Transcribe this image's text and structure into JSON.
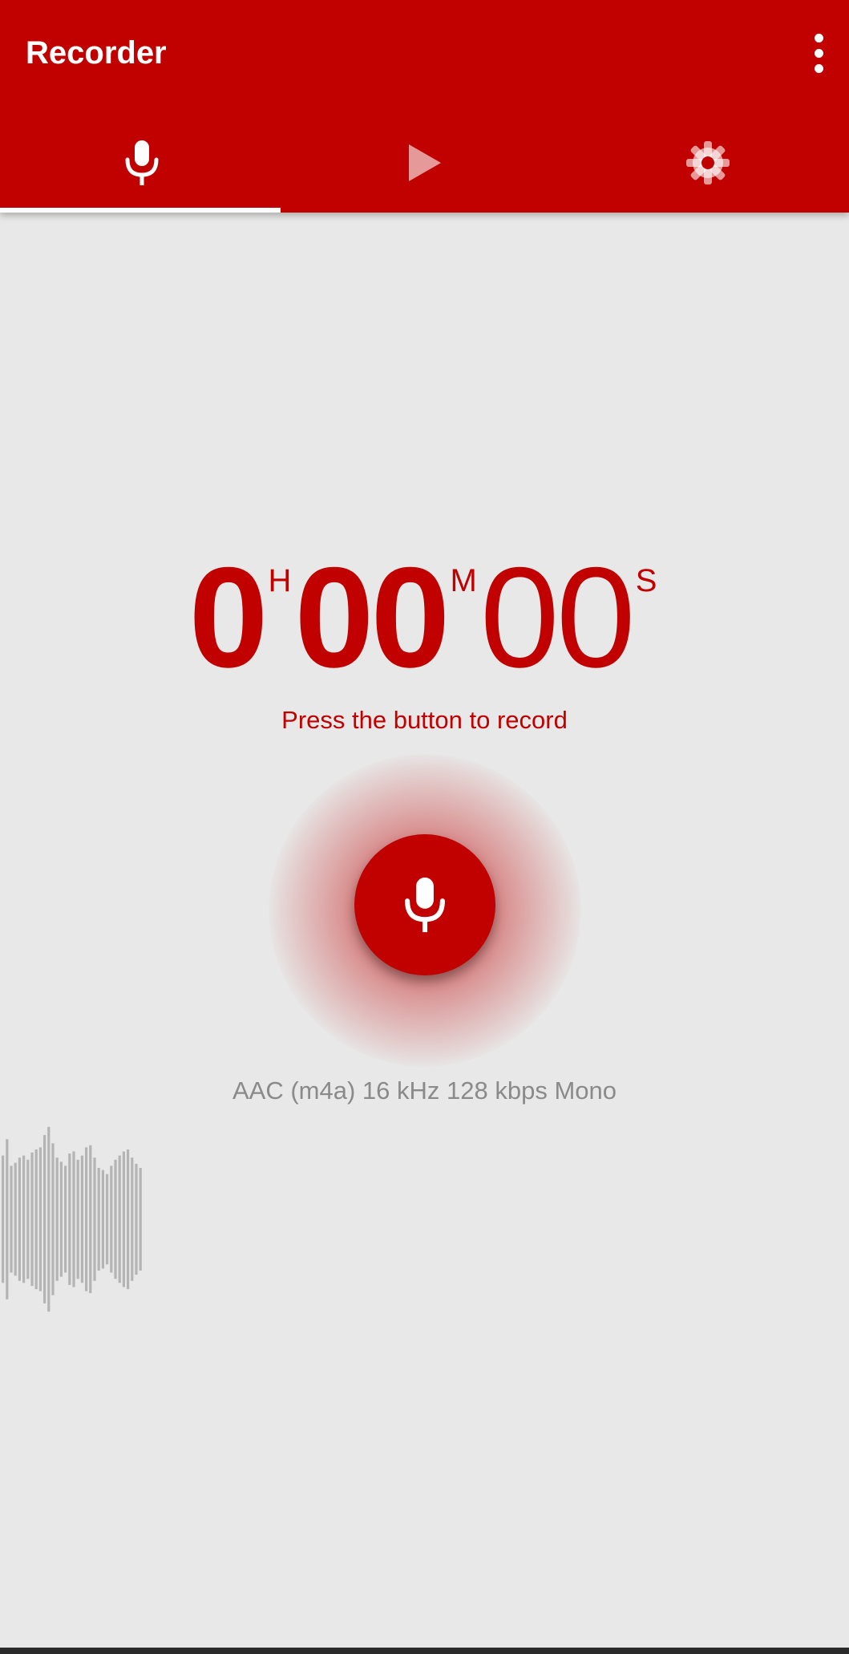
{
  "app": {
    "title": "Recorder",
    "menu_icon": "more-vertical-icon",
    "accent_color": "#c10000"
  },
  "tabs": [
    {
      "name": "record",
      "icon": "mic-icon",
      "selected": true
    },
    {
      "name": "playback",
      "icon": "play-icon",
      "selected": false
    },
    {
      "name": "settings",
      "icon": "gear-icon",
      "selected": false
    }
  ],
  "timer": {
    "hours": "0",
    "hours_unit": "H",
    "minutes": "00",
    "minutes_unit": "M",
    "seconds": "00",
    "seconds_unit": "S"
  },
  "hint": "Press the button to record",
  "record_button": {
    "icon": "mic-icon"
  },
  "format_info": "AAC (m4a) 16 kHz 128 kbps Mono",
  "waveform": {
    "levels": [
      0.62,
      0.78,
      0.52,
      0.55,
      0.6,
      0.62,
      0.58,
      0.65,
      0.68,
      0.7,
      0.82,
      0.9,
      0.74,
      0.6,
      0.56,
      0.52,
      0.64,
      0.66,
      0.58,
      0.62,
      0.7,
      0.72,
      0.6,
      0.5,
      0.48,
      0.44,
      0.52,
      0.58,
      0.62,
      0.66,
      0.68,
      0.6,
      0.54,
      0.5
    ]
  }
}
